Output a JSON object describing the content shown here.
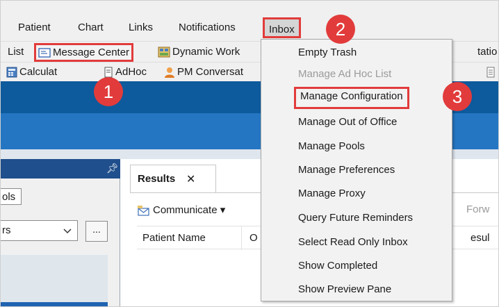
{
  "menubar": {
    "items": [
      {
        "label": "Patient"
      },
      {
        "label": "Chart"
      },
      {
        "label": "Links"
      },
      {
        "label": "Notifications"
      },
      {
        "label": "Inbox"
      }
    ]
  },
  "toolbar1": {
    "items": [
      {
        "label": "List"
      },
      {
        "label": "Message Center"
      },
      {
        "label": "Dynamic Work"
      },
      {
        "label": "tatio"
      }
    ]
  },
  "toolbar2": {
    "items": [
      {
        "label": "Calculat"
      },
      {
        "label": "AdHoc"
      },
      {
        "label": "PM Conversat"
      }
    ]
  },
  "left_pane": {
    "tab_label": "ols",
    "select_value": "rs",
    "ellipsis_label": "..."
  },
  "results": {
    "tab_label": "Results",
    "close_glyph": "✕",
    "communicate_label": "Communicate",
    "forward_partial": "Forw",
    "columns": [
      "Patient Name",
      "O",
      "esul"
    ]
  },
  "dropdown": {
    "items": [
      {
        "label": "Empty Trash",
        "enabled": true
      },
      {
        "label": "Manage Ad Hoc List",
        "enabled": false
      },
      {
        "label": "Manage Configuration",
        "enabled": true,
        "highlighted": true
      },
      {
        "label": "Manage Out of Office",
        "enabled": true
      },
      {
        "label": "Manage Pools",
        "enabled": true
      },
      {
        "label": "Manage Preferences",
        "enabled": true
      },
      {
        "label": "Manage Proxy",
        "enabled": true
      },
      {
        "label": "Query Future Reminders",
        "enabled": true
      },
      {
        "label": "Select Read Only Inbox",
        "enabled": true
      },
      {
        "label": "Show Completed",
        "enabled": true
      },
      {
        "label": "Show Preview Pane",
        "enabled": true
      }
    ]
  },
  "badges": {
    "step1": "1",
    "step2": "2",
    "step3": "3"
  },
  "colors": {
    "highlight": "#e23b3b",
    "band_dark": "#0d5a9c",
    "band_light": "#2476c3"
  }
}
